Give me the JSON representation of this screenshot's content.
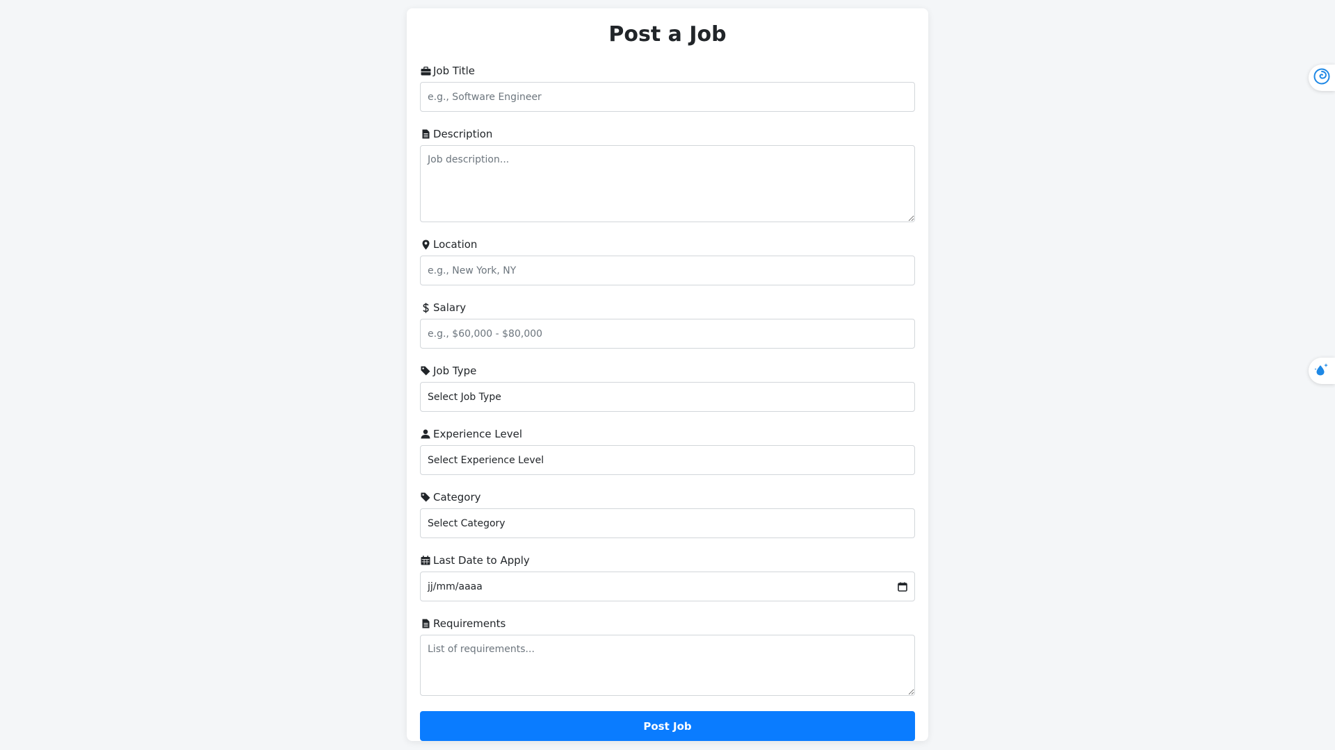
{
  "page": {
    "title": "Post a Job"
  },
  "fields": {
    "job_title": {
      "label": "Job Title",
      "icon": "briefcase-icon",
      "placeholder": "e.g., Software Engineer",
      "value": ""
    },
    "description": {
      "label": "Description",
      "icon": "file-icon",
      "placeholder": "Job description...",
      "value": ""
    },
    "location": {
      "label": "Location",
      "icon": "map-pin-icon",
      "placeholder": "e.g., New York, NY",
      "value": ""
    },
    "salary": {
      "label": "Salary",
      "icon": "dollar-icon",
      "placeholder": "e.g., $60,000 - $80,000",
      "value": ""
    },
    "job_type": {
      "label": "Job Type",
      "icon": "tag-icon",
      "selected": "Select Job Type"
    },
    "experience_level": {
      "label": "Experience Level",
      "icon": "user-icon",
      "selected": "Select Experience Level"
    },
    "category": {
      "label": "Category",
      "icon": "tag-icon",
      "selected": "Select Category"
    },
    "last_date": {
      "label": "Last Date to Apply",
      "icon": "calendar-icon",
      "value": "jj/mm/aaaa"
    },
    "requirements": {
      "label": "Requirements",
      "icon": "file-icon",
      "placeholder": "List of requirements...",
      "value": ""
    }
  },
  "submit": {
    "label": "Post Job"
  },
  "colors": {
    "accent": "#0a7cff",
    "background": "#f4f6f8",
    "card": "#ffffff",
    "border": "#d2d6da"
  },
  "side_widgets": [
    {
      "icon": "swirl-logo-icon"
    },
    {
      "icon": "water-drop-sparkle-icon"
    }
  ]
}
